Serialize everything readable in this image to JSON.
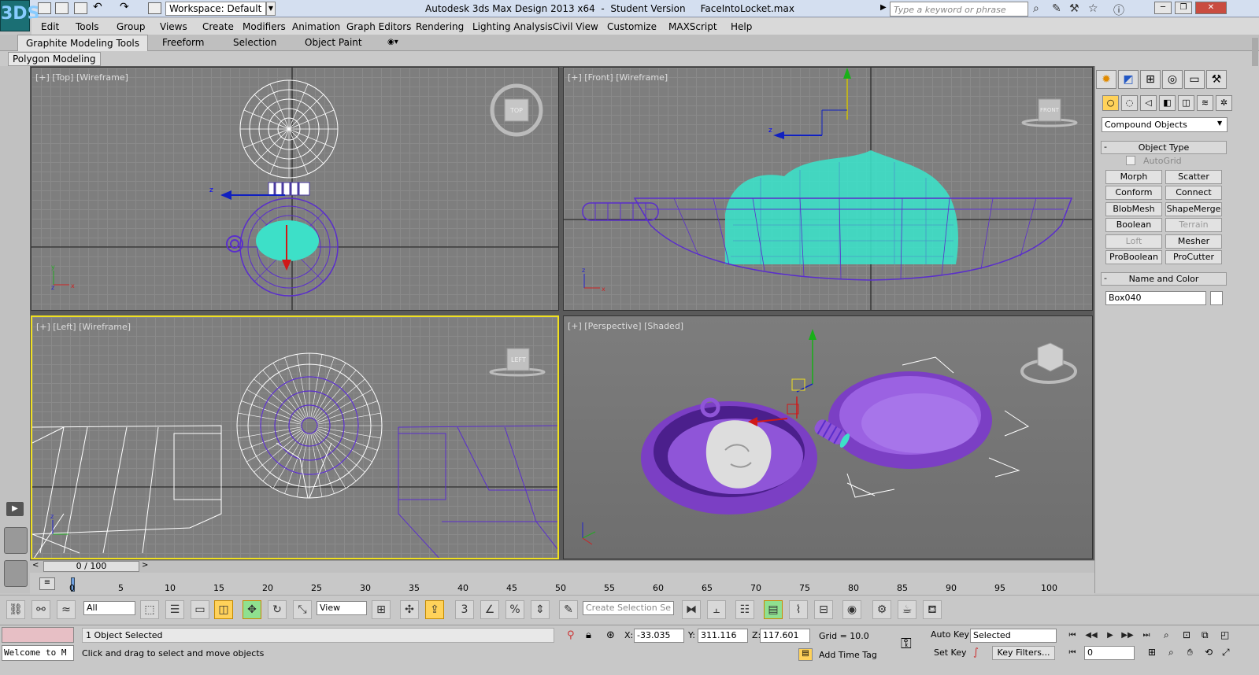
{
  "titlebar": {
    "app_logo": "3DS",
    "workspace": "Workspace: Default",
    "title": "Autodesk 3ds Max Design 2013 x64  -  Student Version     FaceIntoLocket.max",
    "search_placeholder": "Type a keyword or phrase"
  },
  "menu": [
    "Edit",
    "Tools",
    "Group",
    "Views",
    "Create",
    "Modifiers",
    "Animation",
    "Graph Editors",
    "Rendering",
    "Lighting Analysis",
    "Civil View",
    "Customize",
    "MAXScript",
    "Help"
  ],
  "ribbon": {
    "tabs": [
      "Graphite Modeling Tools",
      "Freeform",
      "Selection",
      "Object Paint"
    ],
    "panel_label": "Polygon Modeling"
  },
  "viewports": {
    "top": {
      "label": "[+] [Top] [Wireframe]",
      "cube": "TOP"
    },
    "front": {
      "label": "[+] [Front] [Wireframe]",
      "cube": "FRONT"
    },
    "left": {
      "label": "[+] [Left] [Wireframe]",
      "cube": "LEFT"
    },
    "perspective": {
      "label": "[+] [Perspective] [Shaded]"
    }
  },
  "command_panel": {
    "category": "Compound Objects",
    "object_type_title": "Object Type",
    "autogrid": "AutoGrid",
    "buttons": [
      "Morph",
      "Scatter",
      "Conform",
      "Connect",
      "BlobMesh",
      "ShapeMerge",
      "Boolean",
      "Terrain",
      "Loft",
      "Mesher",
      "ProBoolean",
      "ProCutter"
    ],
    "name_color_title": "Name and Color",
    "object_name": "Box040"
  },
  "timeline": {
    "frame_indicator": "0 / 100",
    "ticks": [
      "0",
      "5",
      "10",
      "15",
      "20",
      "25",
      "30",
      "35",
      "40",
      "45",
      "50",
      "55",
      "60",
      "65",
      "70",
      "75",
      "80",
      "85",
      "90",
      "95",
      "100"
    ]
  },
  "toolbar": {
    "selection_filter": "All",
    "ref_coord": "View",
    "named_selection": "Create Selection Se"
  },
  "status": {
    "maxscript_listener": "Welcome to M",
    "selection": "1 Object Selected",
    "prompt": "Click and drag to select and move objects",
    "x_label": "X:",
    "x": "-33.035",
    "y_label": "Y:",
    "y": "311.116",
    "z_label": "Z:",
    "z": "117.601",
    "grid": "Grid = 10.0",
    "add_time_tag": "Add Time Tag",
    "auto_key": "Auto Key",
    "set_key": "Set Key",
    "key_mode": "Selected",
    "key_filters": "Key Filters...",
    "current_frame": "0"
  }
}
